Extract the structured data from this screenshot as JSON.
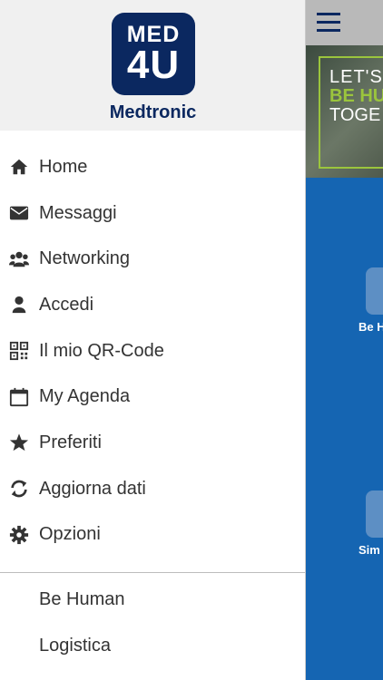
{
  "drawer": {
    "logo_line1": "MED",
    "logo_line2": "4U",
    "brand": "Medtronic",
    "items": [
      {
        "label": "Home",
        "icon": "home-icon"
      },
      {
        "label": "Messaggi",
        "icon": "envelope-icon"
      },
      {
        "label": "Networking",
        "icon": "users-icon"
      },
      {
        "label": "Accedi",
        "icon": "user-icon"
      },
      {
        "label": "Il mio QR-Code",
        "icon": "qrcode-icon"
      },
      {
        "label": "My Agenda",
        "icon": "calendar-icon"
      },
      {
        "label": "Preferiti",
        "icon": "star-icon"
      },
      {
        "label": "Aggiorna dati",
        "icon": "refresh-icon"
      },
      {
        "label": "Opzioni",
        "icon": "gear-icon"
      }
    ],
    "secondary_items": [
      {
        "label": "Be Human"
      },
      {
        "label": "Logistica"
      }
    ]
  },
  "main": {
    "banner": {
      "line1": "LET'S",
      "line2": "BE HU",
      "line3": "TOGE"
    },
    "tiles": [
      {
        "label": "Be H"
      },
      {
        "label": "Sim"
      }
    ]
  },
  "colors": {
    "brand_navy": "#0b2860",
    "main_blue": "#1565b2",
    "banner_green": "#9bc53d",
    "menu_text": "#333333",
    "header_bg": "#f0f0f0"
  }
}
